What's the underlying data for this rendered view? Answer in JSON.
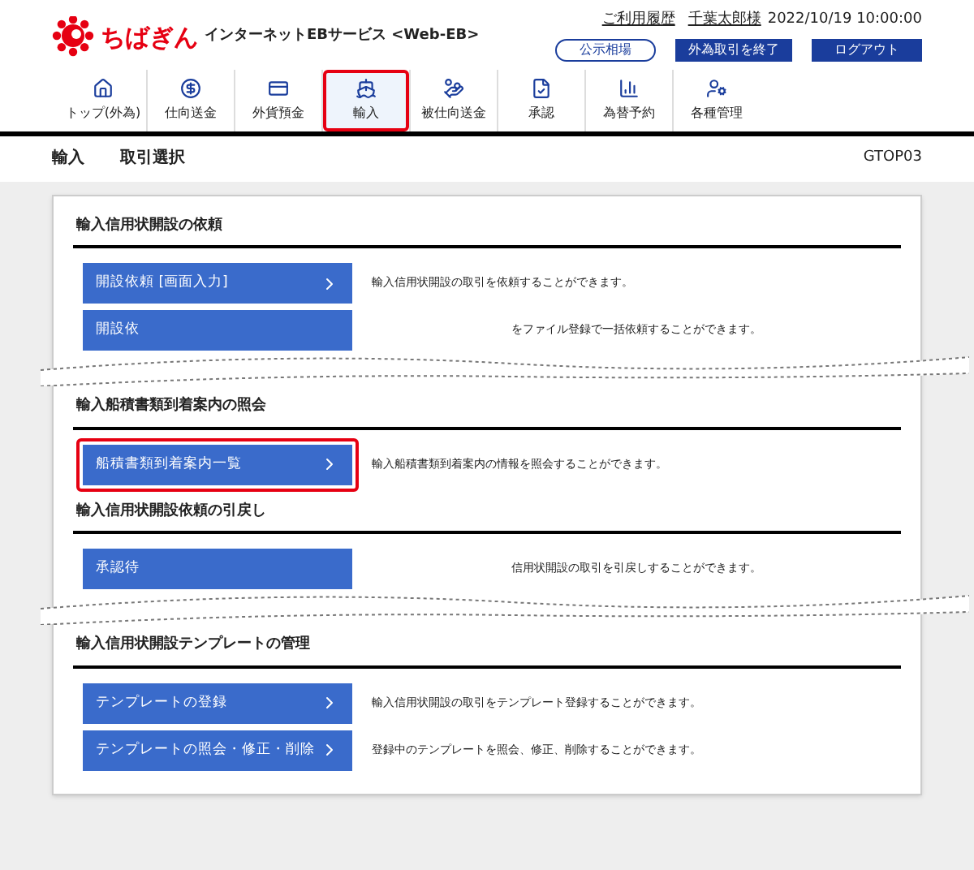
{
  "header": {
    "logo": "ちばぎん",
    "service": "インターネットEBサービス <Web-EB>",
    "history_link": "ご利用履歴",
    "user": "千葉太郎様",
    "datetime": "2022/10/19 10:00:00",
    "buttons": [
      {
        "label": "公示相場",
        "kind": "outline"
      },
      {
        "label": "外為取引を終了",
        "kind": "solid"
      },
      {
        "label": "ログアウト",
        "kind": "solid"
      }
    ]
  },
  "nav": [
    {
      "label": "トップ(外為)",
      "selected": false
    },
    {
      "label": "仕向送金",
      "selected": false
    },
    {
      "label": "外貨預金",
      "selected": false
    },
    {
      "label": "輸入",
      "selected": true
    },
    {
      "label": "被仕向送金",
      "selected": false
    },
    {
      "label": "承認",
      "selected": false
    },
    {
      "label": "為替予約",
      "selected": false
    },
    {
      "label": "各種管理",
      "selected": false
    }
  ],
  "breadcrumb": {
    "items": [
      "輸入",
      "取引選択"
    ],
    "screen_id": "GTOP03"
  },
  "sections": [
    {
      "title": "輸入信用状開設の依頼",
      "rows": [
        {
          "label": "開設依頼 [画面入力]",
          "description": "輸入信用状開設の取引を依頼することができます。",
          "highlighted": false,
          "kind": "full"
        },
        {
          "label": "開設依",
          "description": "をファイル登録で一括依頼することができます。",
          "highlighted": false,
          "kind": "cut"
        }
      ]
    },
    {
      "title": "輸入船積書類到着案内の照会",
      "rows": [
        {
          "label": "船積書類到着案内一覧",
          "description": "輸入船積書類到着案内の情報を照会することができます。",
          "highlighted": true,
          "kind": "full"
        }
      ]
    },
    {
      "title": "輸入信用状開設依頼の引戻し",
      "rows": [
        {
          "label": "承認待",
          "description": "信用状開設の取引を引戻しすることができます。",
          "highlighted": false,
          "kind": "cut"
        }
      ]
    },
    {
      "title": "輸入信用状開設テンプレートの管理",
      "rows": [
        {
          "label": "テンプレートの登録",
          "description": "輸入信用状開設の取引をテンプレート登録することができます。",
          "highlighted": false,
          "kind": "full"
        },
        {
          "label": "テンプレートの照会・修正・削除",
          "description": "登録中のテンプレートを照会、修正、削除することができます。",
          "highlighted": false,
          "kind": "full"
        }
      ]
    }
  ]
}
